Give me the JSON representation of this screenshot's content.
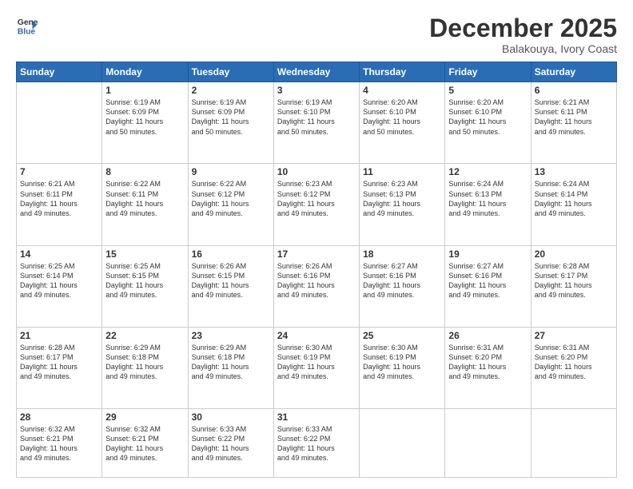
{
  "logo": {
    "line1": "General",
    "line2": "Blue"
  },
  "title": "December 2025",
  "location": "Balakouya, Ivory Coast",
  "weekdays": [
    "Sunday",
    "Monday",
    "Tuesday",
    "Wednesday",
    "Thursday",
    "Friday",
    "Saturday"
  ],
  "weeks": [
    [
      {
        "day": "",
        "info": ""
      },
      {
        "day": "1",
        "info": "Sunrise: 6:19 AM\nSunset: 6:09 PM\nDaylight: 11 hours\nand 50 minutes."
      },
      {
        "day": "2",
        "info": "Sunrise: 6:19 AM\nSunset: 6:09 PM\nDaylight: 11 hours\nand 50 minutes."
      },
      {
        "day": "3",
        "info": "Sunrise: 6:19 AM\nSunset: 6:10 PM\nDaylight: 11 hours\nand 50 minutes."
      },
      {
        "day": "4",
        "info": "Sunrise: 6:20 AM\nSunset: 6:10 PM\nDaylight: 11 hours\nand 50 minutes."
      },
      {
        "day": "5",
        "info": "Sunrise: 6:20 AM\nSunset: 6:10 PM\nDaylight: 11 hours\nand 50 minutes."
      },
      {
        "day": "6",
        "info": "Sunrise: 6:21 AM\nSunset: 6:11 PM\nDaylight: 11 hours\nand 49 minutes."
      }
    ],
    [
      {
        "day": "7",
        "info": "Sunrise: 6:21 AM\nSunset: 6:11 PM\nDaylight: 11 hours\nand 49 minutes."
      },
      {
        "day": "8",
        "info": "Sunrise: 6:22 AM\nSunset: 6:11 PM\nDaylight: 11 hours\nand 49 minutes."
      },
      {
        "day": "9",
        "info": "Sunrise: 6:22 AM\nSunset: 6:12 PM\nDaylight: 11 hours\nand 49 minutes."
      },
      {
        "day": "10",
        "info": "Sunrise: 6:23 AM\nSunset: 6:12 PM\nDaylight: 11 hours\nand 49 minutes."
      },
      {
        "day": "11",
        "info": "Sunrise: 6:23 AM\nSunset: 6:13 PM\nDaylight: 11 hours\nand 49 minutes."
      },
      {
        "day": "12",
        "info": "Sunrise: 6:24 AM\nSunset: 6:13 PM\nDaylight: 11 hours\nand 49 minutes."
      },
      {
        "day": "13",
        "info": "Sunrise: 6:24 AM\nSunset: 6:14 PM\nDaylight: 11 hours\nand 49 minutes."
      }
    ],
    [
      {
        "day": "14",
        "info": "Sunrise: 6:25 AM\nSunset: 6:14 PM\nDaylight: 11 hours\nand 49 minutes."
      },
      {
        "day": "15",
        "info": "Sunrise: 6:25 AM\nSunset: 6:15 PM\nDaylight: 11 hours\nand 49 minutes."
      },
      {
        "day": "16",
        "info": "Sunrise: 6:26 AM\nSunset: 6:15 PM\nDaylight: 11 hours\nand 49 minutes."
      },
      {
        "day": "17",
        "info": "Sunrise: 6:26 AM\nSunset: 6:16 PM\nDaylight: 11 hours\nand 49 minutes."
      },
      {
        "day": "18",
        "info": "Sunrise: 6:27 AM\nSunset: 6:16 PM\nDaylight: 11 hours\nand 49 minutes."
      },
      {
        "day": "19",
        "info": "Sunrise: 6:27 AM\nSunset: 6:16 PM\nDaylight: 11 hours\nand 49 minutes."
      },
      {
        "day": "20",
        "info": "Sunrise: 6:28 AM\nSunset: 6:17 PM\nDaylight: 11 hours\nand 49 minutes."
      }
    ],
    [
      {
        "day": "21",
        "info": "Sunrise: 6:28 AM\nSunset: 6:17 PM\nDaylight: 11 hours\nand 49 minutes."
      },
      {
        "day": "22",
        "info": "Sunrise: 6:29 AM\nSunset: 6:18 PM\nDaylight: 11 hours\nand 49 minutes."
      },
      {
        "day": "23",
        "info": "Sunrise: 6:29 AM\nSunset: 6:18 PM\nDaylight: 11 hours\nand 49 minutes."
      },
      {
        "day": "24",
        "info": "Sunrise: 6:30 AM\nSunset: 6:19 PM\nDaylight: 11 hours\nand 49 minutes."
      },
      {
        "day": "25",
        "info": "Sunrise: 6:30 AM\nSunset: 6:19 PM\nDaylight: 11 hours\nand 49 minutes."
      },
      {
        "day": "26",
        "info": "Sunrise: 6:31 AM\nSunset: 6:20 PM\nDaylight: 11 hours\nand 49 minutes."
      },
      {
        "day": "27",
        "info": "Sunrise: 6:31 AM\nSunset: 6:20 PM\nDaylight: 11 hours\nand 49 minutes."
      }
    ],
    [
      {
        "day": "28",
        "info": "Sunrise: 6:32 AM\nSunset: 6:21 PM\nDaylight: 11 hours\nand 49 minutes."
      },
      {
        "day": "29",
        "info": "Sunrise: 6:32 AM\nSunset: 6:21 PM\nDaylight: 11 hours\nand 49 minutes."
      },
      {
        "day": "30",
        "info": "Sunrise: 6:33 AM\nSunset: 6:22 PM\nDaylight: 11 hours\nand 49 minutes."
      },
      {
        "day": "31",
        "info": "Sunrise: 6:33 AM\nSunset: 6:22 PM\nDaylight: 11 hours\nand 49 minutes."
      },
      {
        "day": "",
        "info": ""
      },
      {
        "day": "",
        "info": ""
      },
      {
        "day": "",
        "info": ""
      }
    ]
  ]
}
